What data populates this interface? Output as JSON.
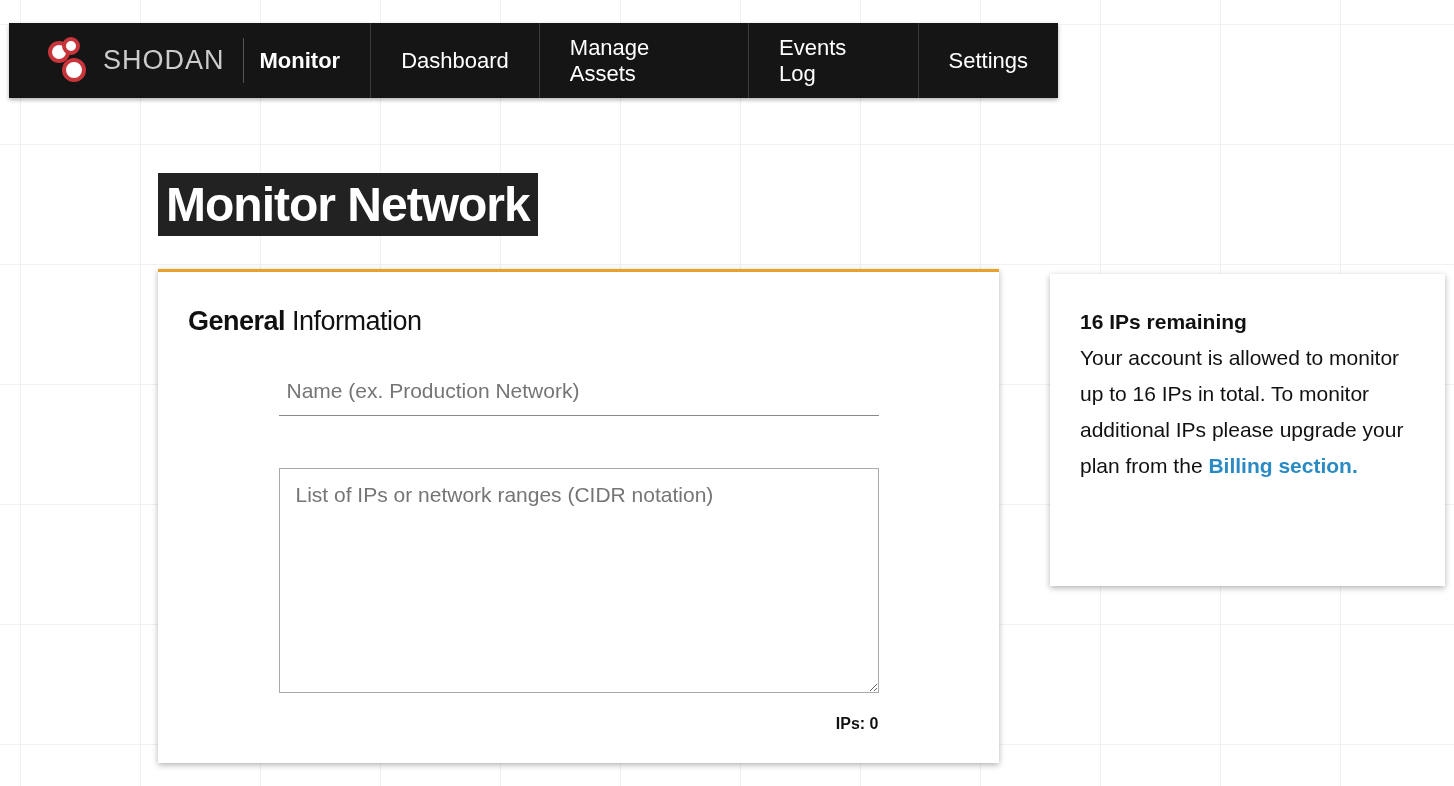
{
  "navbar": {
    "brand": "SHODAN",
    "product": "Monitor",
    "items": [
      {
        "label": "Dashboard"
      },
      {
        "label": "Manage Assets"
      },
      {
        "label": "Events Log"
      },
      {
        "label": "Settings"
      }
    ]
  },
  "page_title": "Monitor Network",
  "form": {
    "heading": "**General** Information",
    "name_field": {
      "placeholder": "Name (ex. Production Network)"
    },
    "ips_field": {
      "placeholder": "List of IPs or network ranges (CIDR notation)"
    },
    "ip_count": "IPs: 0"
  },
  "info_panel": {
    "title": "16 IPs remaining",
    "text": "Your account is allowed to monitor up to 16 IPs in total. To monitor additional IPs please upgrade your plan from the",
    "link": "Billing section."
  }
}
